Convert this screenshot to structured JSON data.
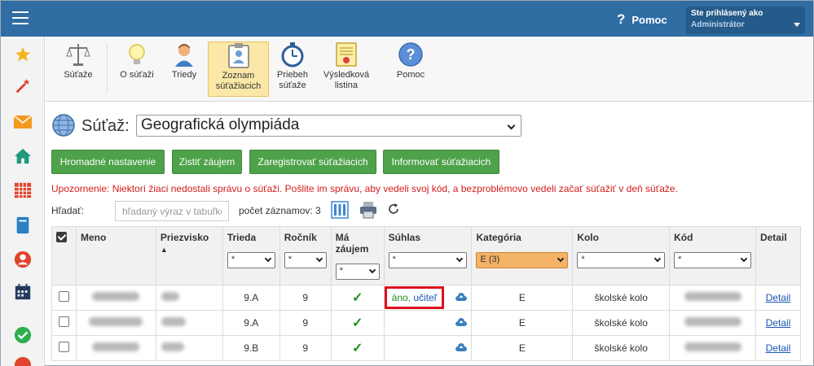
{
  "header": {
    "help_label": "Pomoc",
    "help_mark": "?",
    "user_line1": "Ste prihlásený ako",
    "user_line2": "Administrátor"
  },
  "sidebar": {
    "items": [
      "star-icon",
      "magic-wand-icon",
      "envelope-icon",
      "home-icon",
      "calendar-grid-icon",
      "book-icon",
      "user-circle-icon",
      "schedule-icon",
      "approved-icon",
      "alert-icon"
    ]
  },
  "toolbar": {
    "buttons": [
      {
        "label": "Súťaže",
        "icon": "scales-icon"
      },
      {
        "label": "O súťaži",
        "icon": "lightbulb-icon"
      },
      {
        "label": "Triedy",
        "icon": "student-icon"
      },
      {
        "label": "Zoznam\nsúťažiacich",
        "icon": "clipboard-icon",
        "active": true
      },
      {
        "label": "Priebeh\nsúťaže",
        "icon": "stopwatch-icon"
      },
      {
        "label": "Výsledková\nlistina",
        "icon": "certificate-icon"
      },
      {
        "label": "Pomoc",
        "icon": "help-icon"
      }
    ]
  },
  "contest": {
    "label": "Súťaž:",
    "selected": "Geografická olympiáda"
  },
  "actions": {
    "bulk_settings": "Hromadné nastavenie",
    "find_interest": "Zistiť záujem",
    "register": "Zaregistrovať súťažiacich",
    "inform": "Informovať súťažiacich"
  },
  "warning": "Upozornenie: Niektorí žiaci nedostali správu o súťaži. Pošlite im správu, aby vedeli svoj kód, a bezproblémovo vedeli začať súťažiť v deň súťaže.",
  "search": {
    "label": "Hľadať:",
    "placeholder": "hľadaný výraz v tabuľke",
    "count_label": "počet záznamov: 3"
  },
  "table": {
    "headers": {
      "name": "Meno",
      "surname": "Priezvisko",
      "class": "Trieda",
      "year": "Ročník",
      "interest": "Má záujem",
      "consent": "Súhlas",
      "category": "Kategória",
      "round": "Kolo",
      "code": "Kód",
      "detail": "Detail"
    },
    "sort_marker": "▲",
    "filters": {
      "class": "*",
      "year": "*",
      "interest": "*",
      "consent": "*",
      "category": "E (3)",
      "round": "*",
      "code": "*"
    },
    "rows": [
      {
        "class": "9.A",
        "year": "9",
        "interest": "✓",
        "consent_yes": "áno,",
        "consent_who": "učiteľ",
        "category": "E",
        "round": "školské kolo",
        "detail": "Detail"
      },
      {
        "class": "9.A",
        "year": "9",
        "interest": "✓",
        "consent_yes": "",
        "consent_who": "",
        "category": "E",
        "round": "školské kolo",
        "detail": "Detail"
      },
      {
        "class": "9.B",
        "year": "9",
        "interest": "✓",
        "consent_yes": "",
        "consent_who": "",
        "category": "E",
        "round": "školské kolo",
        "detail": "Detail"
      }
    ]
  },
  "colors": {
    "topbar": "#2f6da3",
    "green_button": "#4ea24a",
    "warning": "#d41c1c",
    "highlight_filter": "#f4b266",
    "consent_outline": "#e0101c"
  }
}
